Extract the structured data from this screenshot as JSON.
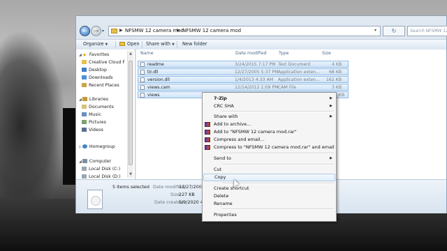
{
  "address_bar": {
    "crumbs": [
      "NFSMW 12 camera mod",
      "NFSMW 12 camera mod"
    ],
    "search_placeholder": "Search NFSMW 12 ca...",
    "back_icon": "arrow-left-icon",
    "forward_icon": "arrow-right-icon"
  },
  "toolbar": {
    "organize": "Organize",
    "open": "Open",
    "share_with": "Share with",
    "new_folder": "New folder"
  },
  "nav_pane": {
    "favorites": "Favorites",
    "favorites_items": [
      "Creative Cloud F",
      "Desktop",
      "Downloads",
      "Recent Places"
    ],
    "libraries": "Libraries",
    "libraries_items": [
      "Documents",
      "Music",
      "Pictures",
      "Videos"
    ],
    "homegroup": "Homegroup",
    "computer": "Computer",
    "computer_items": [
      "Local Disk (C:)",
      "Local Disk (D:)"
    ]
  },
  "file_list": {
    "columns": [
      "Name",
      "Date modified",
      "Type",
      "Size"
    ],
    "rows": [
      {
        "name": "readme",
        "date": "3/24/2015 7:17 PM",
        "type": "Text Document",
        "size": "4 KB"
      },
      {
        "name": "tir.dll",
        "date": "12/27/2005 5:37 PM",
        "type": "Application exten...",
        "size": "68 KB"
      },
      {
        "name": "version.dll",
        "date": "1/4/2013 4:33 AM",
        "type": "Application exten...",
        "size": "162 KB"
      },
      {
        "name": "views.cam",
        "date": "12/14/2012 1:09 PM",
        "type": "CAM File",
        "size": "3 KB"
      },
      {
        "name": "views",
        "date": "",
        "type": "",
        "size": "1 KB"
      }
    ]
  },
  "details_pane": {
    "count": "5 items selected",
    "date_modified_label": "Date modified:",
    "date_modified_value": "12/27/2005",
    "size_label": "Size:",
    "size_value": "227 KB",
    "date_created_label": "Date created:",
    "date_created_value": "5/9/2020 4:4"
  },
  "context_menu": {
    "items": {
      "seven_zip": "7-Zip",
      "crc_sha": "CRC SHA",
      "share_with": "Share with",
      "add_archive": "Add to archive...",
      "add_rar": "Add to \"NFSMW 12 camera mod.rar\"",
      "compress_email": "Compress and email...",
      "compress_rar_email": "Compress to \"NFSMW 12 camera mod.rar\" and email",
      "send_to": "Send to",
      "cut": "Cut",
      "copy": "Copy",
      "create_shortcut": "Create shortcut",
      "delete": "Delete",
      "rename": "Rename",
      "properties": "Properties"
    },
    "highlighted": "Copy"
  }
}
